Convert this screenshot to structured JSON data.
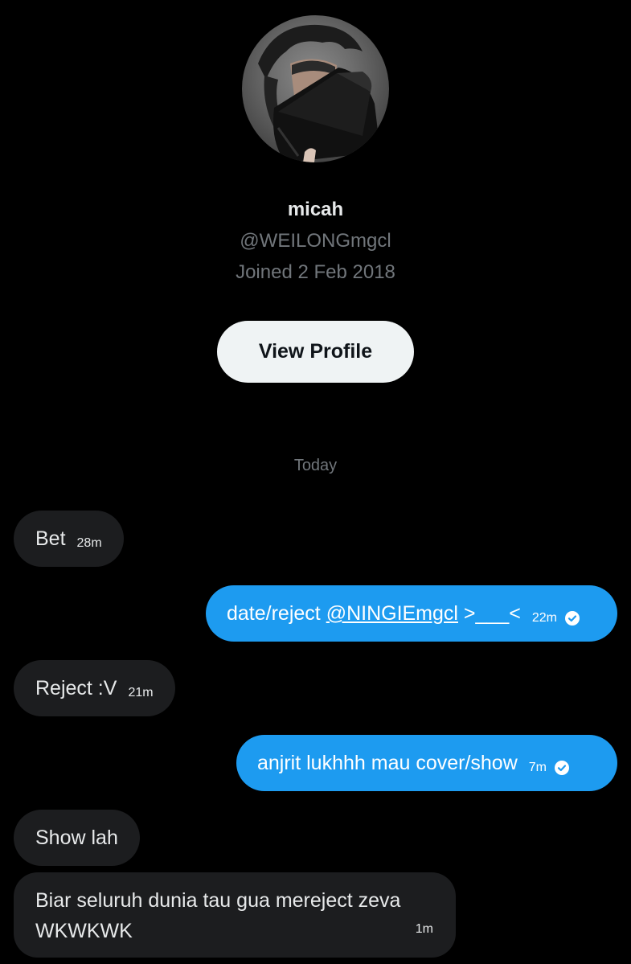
{
  "profile": {
    "name": "micah",
    "handle": "@WEILONGmgcl",
    "joined": "Joined 2 Feb 2018",
    "view_profile_label": "View Profile"
  },
  "conversation": {
    "day_label": "Today",
    "messages": [
      {
        "direction": "incoming",
        "text": "Bet",
        "time": "28m"
      },
      {
        "direction": "outgoing",
        "text_before": "date/reject ",
        "mention": "@NINGIEmgcl",
        "text_after": " >___<",
        "time": "22m",
        "status": "sent"
      },
      {
        "direction": "incoming",
        "text": "Reject :V",
        "time": "21m"
      },
      {
        "direction": "outgoing",
        "text": "anjrit lukhhh mau cover/show",
        "time": "7m",
        "status": "sent"
      },
      {
        "direction": "incoming",
        "text": "Show lah",
        "time": ""
      },
      {
        "direction": "incoming",
        "line1": "Biar seluruh dunia tau gua mereject zeva",
        "line2": "WKWKWK",
        "time": "1m"
      }
    ]
  },
  "colors": {
    "background": "#000000",
    "incoming_bubble": "#1c1d1f",
    "outgoing_bubble": "#1d9bf0",
    "primary_text": "#e7e9ea",
    "secondary_text": "#71767b",
    "button_bg": "#eff3f4"
  },
  "icons": {
    "avatar": "profile-photo",
    "sent_status": "check-circle-icon"
  }
}
